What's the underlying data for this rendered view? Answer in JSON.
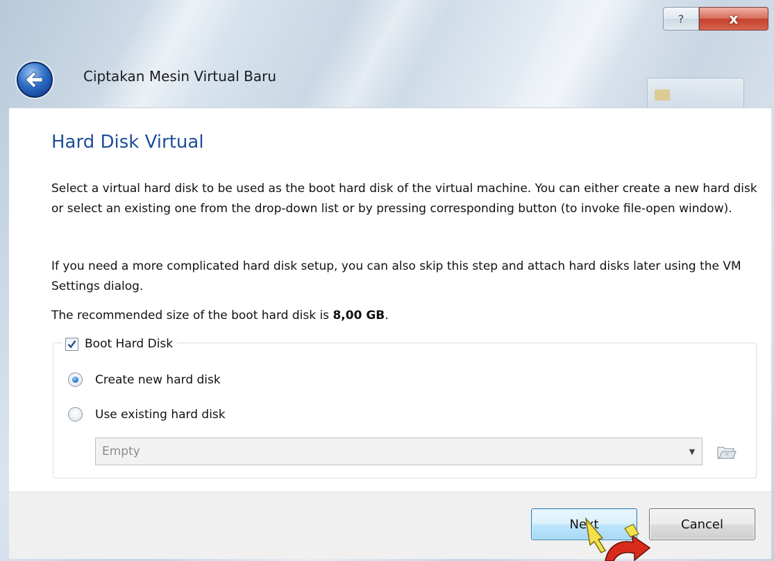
{
  "window": {
    "title": "Ciptakan Mesin Virtual Baru",
    "help_glyph": "?",
    "close_glyph": "x",
    "icons": {
      "back": "back-arrow-icon",
      "help": "help-icon",
      "close": "close-icon"
    }
  },
  "page": {
    "heading": "Hard Disk Virtual",
    "paragraph_1": "Select a virtual hard disk to be used as the boot hard disk of the virtual machine. You can either create a new hard disk or select an existing one from the drop-down list or by pressing corresponding button (to invoke file-open window).",
    "paragraph_2": "If you need a more complicated hard disk setup, you can also skip this step and attach hard disks later using the VM Settings dialog.",
    "recommended_prefix": "The recommended size of the boot hard disk is ",
    "recommended_size": "8,00 GB",
    "recommended_suffix": "."
  },
  "boot_disk": {
    "checkbox_label": "Boot Hard Disk",
    "checked": true,
    "options": [
      {
        "label": "Create new hard disk",
        "selected": true
      },
      {
        "label": "Use existing hard disk",
        "selected": false
      }
    ],
    "existing_disk_value": "Empty",
    "browse_icon": "folder-browse-icon"
  },
  "buttons": {
    "next": "Next",
    "cancel": "Cancel"
  },
  "colors": {
    "heading": "#1f4e9a",
    "close_button": "#c4402d",
    "next_button_border": "#3c7fb1"
  }
}
